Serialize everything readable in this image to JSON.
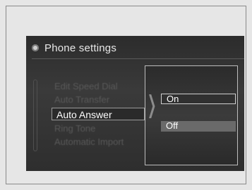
{
  "header": {
    "title": "Phone settings"
  },
  "menu": {
    "items": [
      {
        "label": "Edit Speed Dial"
      },
      {
        "label": "Auto Transfer"
      },
      {
        "label": "Auto Answer"
      },
      {
        "label": "Ring Tone"
      },
      {
        "label": "Automatic Import"
      }
    ],
    "selected_label": "Auto Answer"
  },
  "popup": {
    "options": [
      {
        "label": "On"
      },
      {
        "label": "Off"
      }
    ],
    "selected": "Off"
  }
}
